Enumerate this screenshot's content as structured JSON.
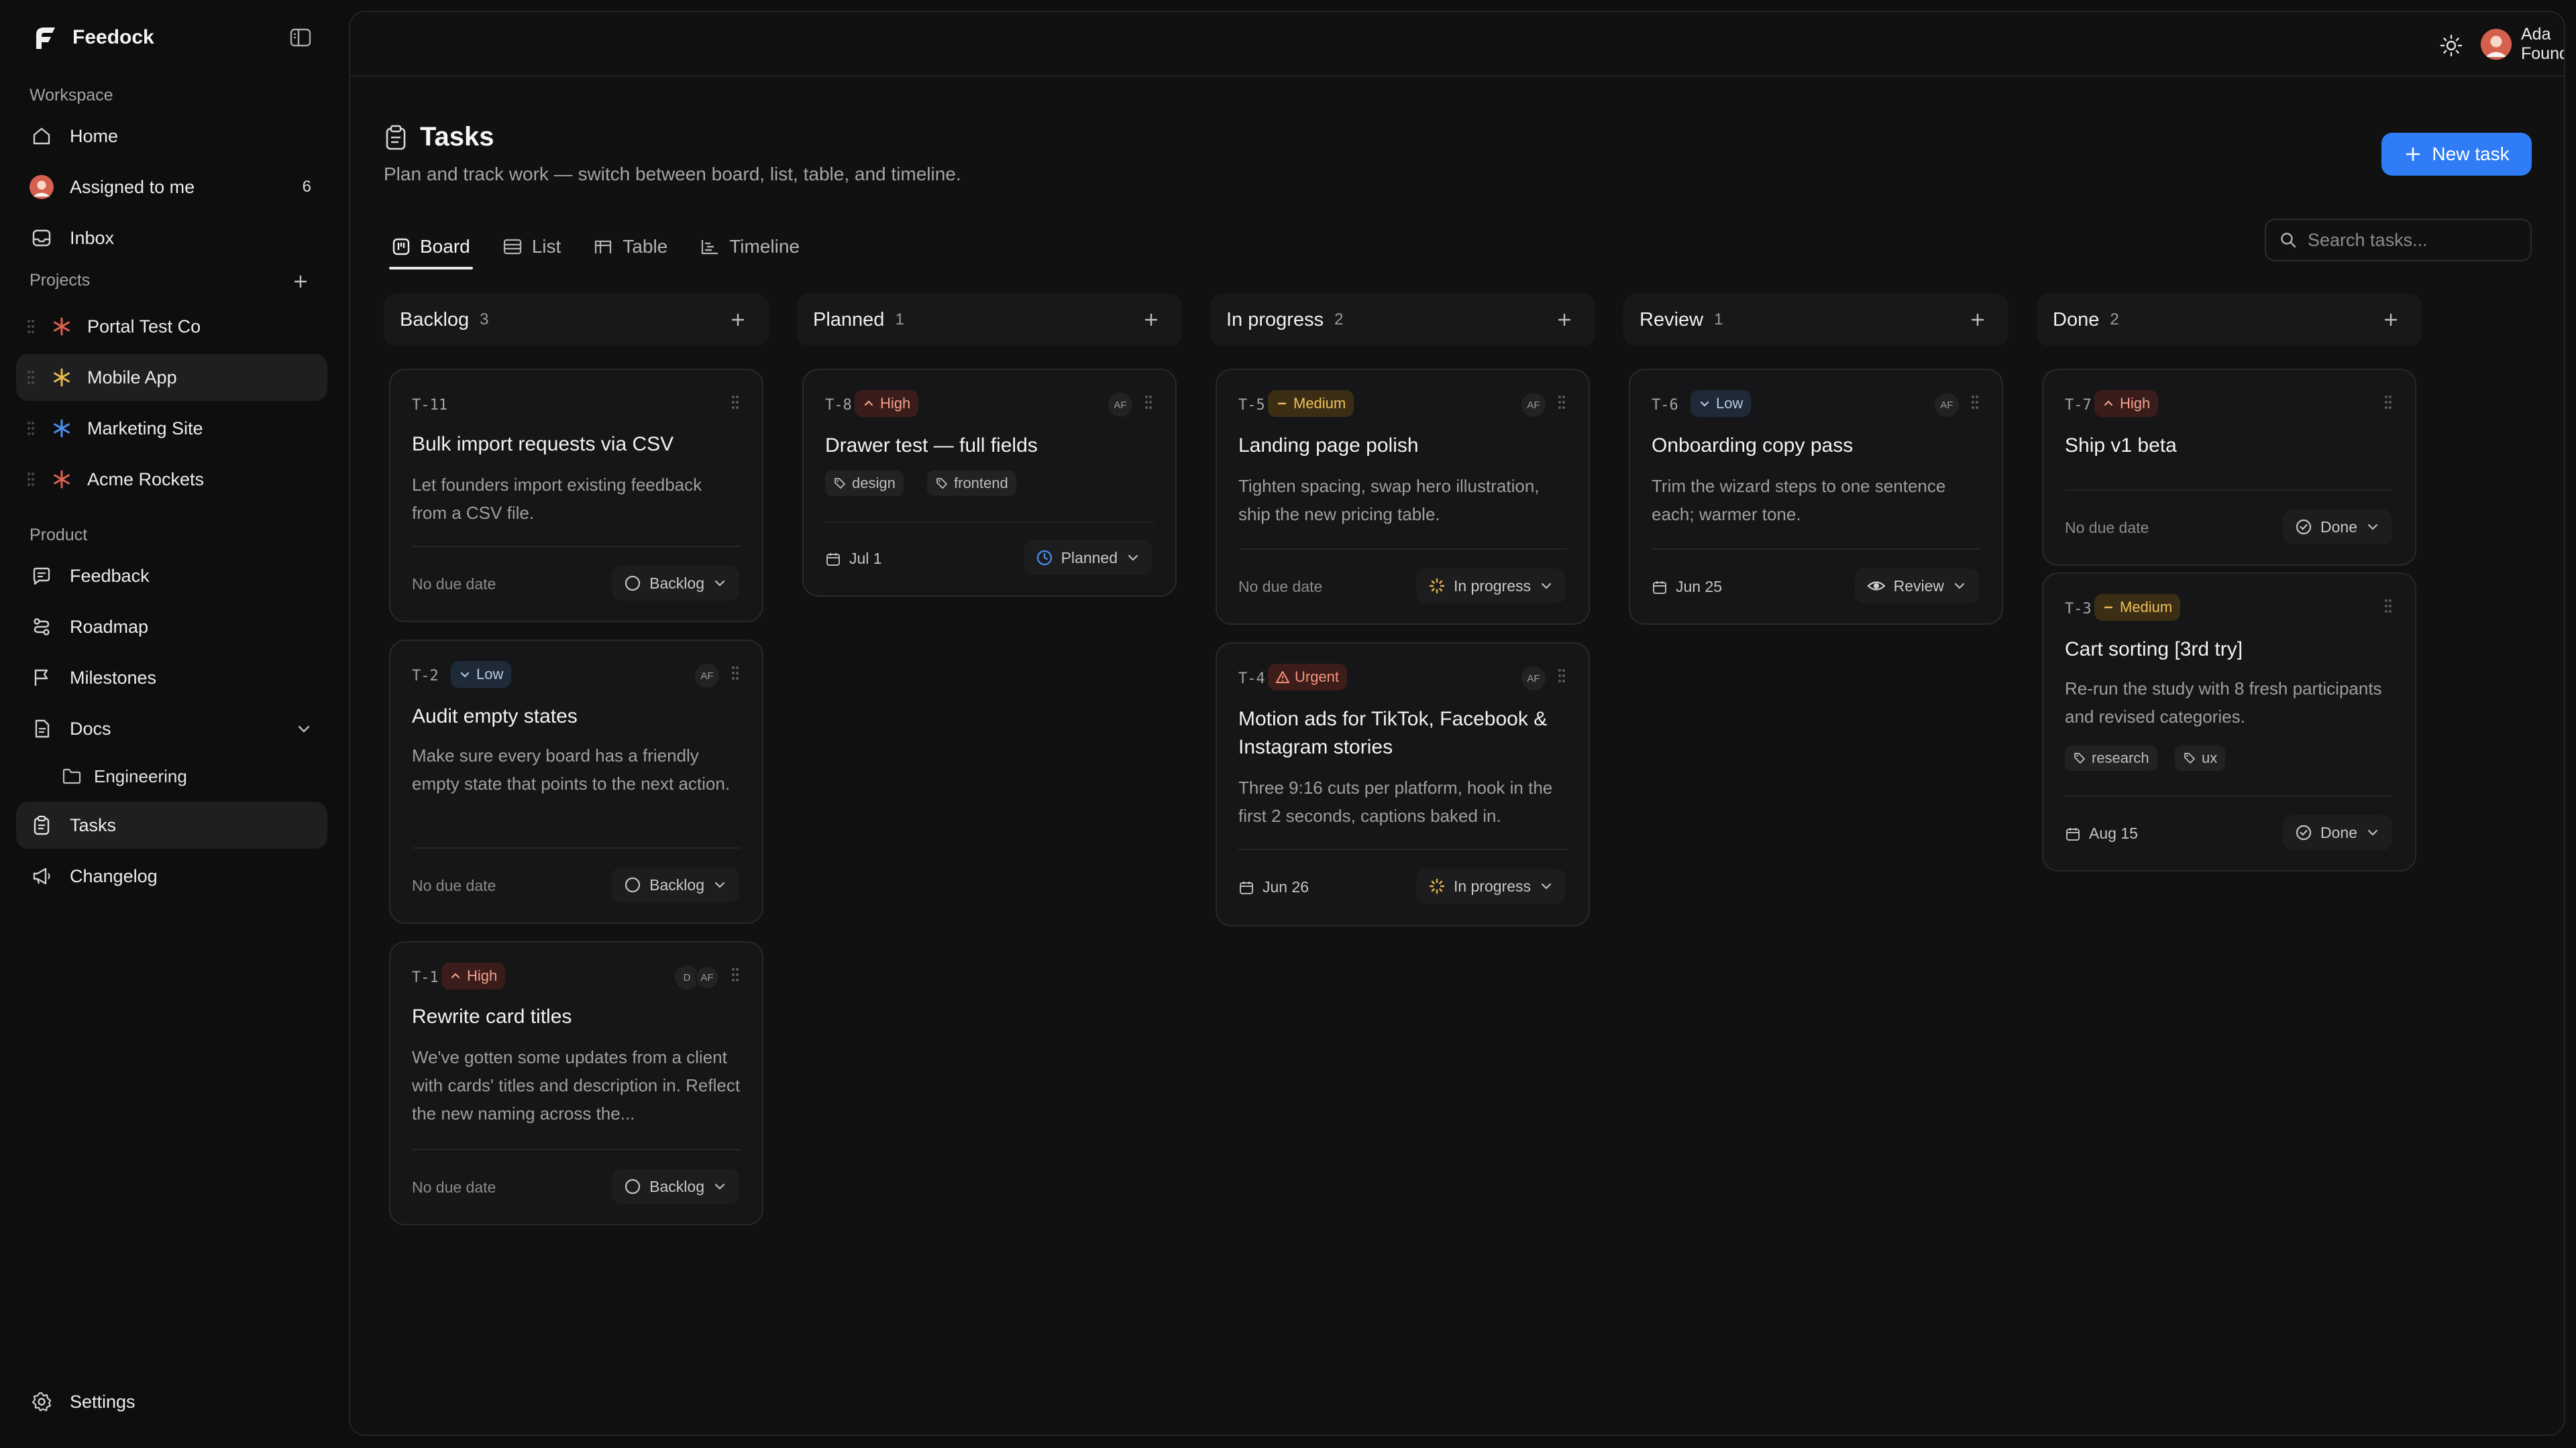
{
  "app": {
    "name": "Feedock"
  },
  "sidebar": {
    "workspace_label": "Workspace",
    "home": "Home",
    "assigned": "Assigned to me",
    "assigned_count": "6",
    "inbox": "Inbox",
    "projects_label": "Projects",
    "projects": [
      {
        "name": "Portal Test Co",
        "color": "#e0604f"
      },
      {
        "name": "Mobile App",
        "color": "#e8b94a"
      },
      {
        "name": "Marketing Site",
        "color": "#4c8ff0"
      },
      {
        "name": "Acme Rockets",
        "color": "#e0604f"
      }
    ],
    "product_label": "Product",
    "feedback": "Feedback",
    "roadmap": "Roadmap",
    "milestones": "Milestones",
    "docs": "Docs",
    "engineering": "Engineering",
    "tasks": "Tasks",
    "changelog": "Changelog",
    "settings": "Settings"
  },
  "topbar": {
    "user_name": "Ada Founder"
  },
  "page": {
    "title": "Tasks",
    "subtitle": "Plan and track work — switch between board, list, table, and timeline.",
    "new_task": "New task",
    "search_placeholder": "Search tasks..."
  },
  "tabs": {
    "board": "Board",
    "list": "List",
    "table": "Table",
    "timeline": "Timeline",
    "active": "Board"
  },
  "columns": [
    {
      "title": "Backlog",
      "count": "3"
    },
    {
      "title": "Planned",
      "count": "1"
    },
    {
      "title": "In progress",
      "count": "2"
    },
    {
      "title": "Review",
      "count": "1"
    },
    {
      "title": "Done",
      "count": "2"
    }
  ],
  "cards": {
    "t11": {
      "key": "T-11",
      "title": "Bulk import requests via CSV",
      "desc": "Let founders import existing feedback from a CSV file.",
      "due": "No due date",
      "status": "Backlog"
    },
    "t2": {
      "key": "T-2",
      "priority": "Low",
      "assignee": "AF",
      "title": "Audit empty states",
      "desc": "Make sure every board has a friendly empty state that points to the next action.",
      "due": "No due date",
      "status": "Backlog"
    },
    "t1": {
      "key": "T-1",
      "priority": "High",
      "assignee": "AF",
      "assignee2": "D",
      "title": "Rewrite card titles",
      "desc": "We've gotten some updates from a client with cards' titles and description in. Reflect the new naming across the...",
      "due": "No due date",
      "status": "Backlog"
    },
    "t8": {
      "key": "T-8",
      "priority": "High",
      "assignee": "AF",
      "title": "Drawer test — full fields",
      "tags": [
        "design",
        "frontend"
      ],
      "due": "Jul 1",
      "status": "Planned"
    },
    "t5": {
      "key": "T-5",
      "priority": "Medium",
      "assignee": "AF",
      "title": "Landing page polish",
      "desc": "Tighten spacing, swap hero illustration, ship the new pricing table.",
      "due": "No due date",
      "status": "In progress"
    },
    "t4": {
      "key": "T-4",
      "priority": "Urgent",
      "assignee": "AF",
      "title": "Motion ads for TikTok, Facebook & Instagram stories",
      "desc": "Three 9:16 cuts per platform, hook in the first 2 seconds, captions baked in.",
      "due": "Jun 26",
      "status": "In progress"
    },
    "t6": {
      "key": "T-6",
      "priority": "Low",
      "assignee": "AF",
      "title": "Onboarding copy pass",
      "desc": "Trim the wizard steps to one sentence each; warmer tone.",
      "due": "Jun 25",
      "status": "Review"
    },
    "t7": {
      "key": "T-7",
      "priority": "High",
      "title": "Ship v1 beta",
      "due": "No due date",
      "status": "Done"
    },
    "t3": {
      "key": "T-3",
      "priority": "Medium",
      "title": "Cart sorting [3rd try]",
      "desc": "Re-run the study with 8 fresh participants and revised categories.",
      "tags": [
        "research",
        "ux"
      ],
      "due": "Aug 15",
      "status": "Done"
    }
  }
}
